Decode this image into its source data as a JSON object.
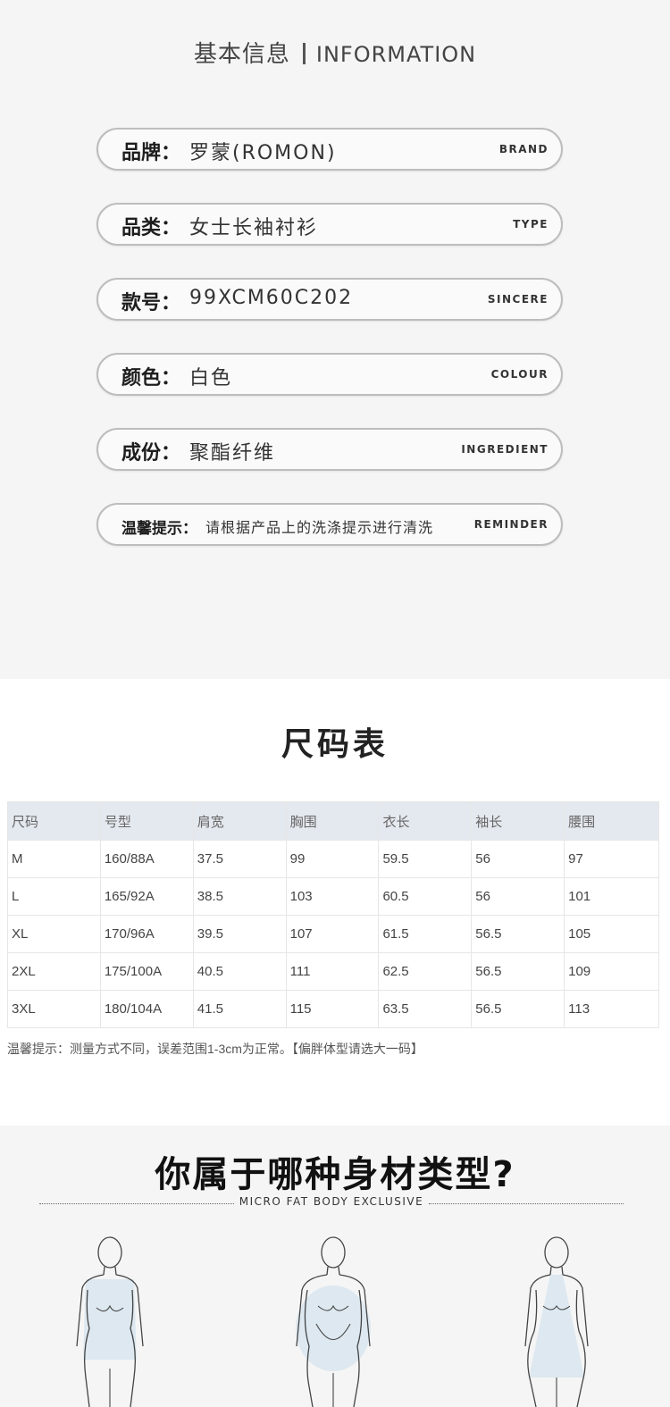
{
  "info": {
    "title_zh": "基本信息",
    "title_en": "INFORMATION",
    "rows": [
      {
        "label": "品牌：",
        "value": "罗蒙(ROMON)",
        "en": "BRAND"
      },
      {
        "label": "品类：",
        "value": "女士长袖衬衫",
        "en": "TYPE"
      },
      {
        "label": "款号：",
        "value": "99XCM60C202",
        "en": "SINCERE"
      },
      {
        "label": "颜色：",
        "value": "白色",
        "en": "COLOUR"
      },
      {
        "label": "成份：",
        "value": "聚酯纤维",
        "en": "INGREDIENT"
      },
      {
        "label": "温馨提示：",
        "value": "请根据产品上的洗涤提示进行清洗",
        "en": "REMINDER"
      }
    ]
  },
  "size_chart": {
    "title": "尺码表",
    "headers": [
      "尺码",
      "号型",
      "肩宽",
      "胸围",
      "衣长",
      "袖长",
      "腰围"
    ],
    "rows": [
      [
        "M",
        "160/88A",
        "37.5",
        "99",
        "59.5",
        "56",
        "97"
      ],
      [
        "L",
        "165/92A",
        "38.5",
        "103",
        "60.5",
        "56",
        "101"
      ],
      [
        "XL",
        "170/96A",
        "39.5",
        "107",
        "61.5",
        "56.5",
        "105"
      ],
      [
        "2XL",
        "175/100A",
        "40.5",
        "111",
        "62.5",
        "56.5",
        "109"
      ],
      [
        "3XL",
        "180/104A",
        "41.5",
        "115",
        "63.5",
        "56.5",
        "113"
      ]
    ],
    "note": "温馨提示：测量方式不同，误差范围1-3cm为正常。【偏胖体型请选大一码】"
  },
  "body_type": {
    "title": "你属于哪种身材类型?",
    "subtitle": "MICRO FAT BODY EXCLUSIVE"
  }
}
